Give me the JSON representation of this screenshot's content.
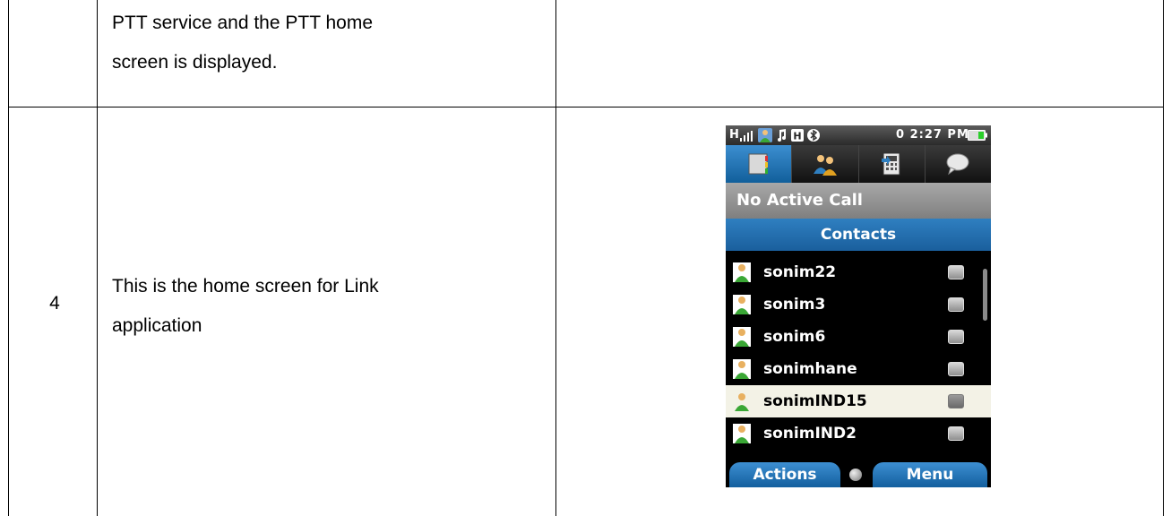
{
  "table": {
    "row1": {
      "step": "",
      "description_lines": [
        "PTT service and the PTT home",
        "screen is displayed."
      ]
    },
    "row2": {
      "step": "4",
      "description_lines": [
        "This is the home screen for Link",
        "application"
      ]
    }
  },
  "phone": {
    "status": {
      "network": "H",
      "time": "0 2:27 PM"
    },
    "tabs": [
      {
        "icon": "ptt-list-icon",
        "active": true
      },
      {
        "icon": "contacts-group-icon",
        "active": false
      },
      {
        "icon": "call-log-icon",
        "active": false
      },
      {
        "icon": "message-bubble-icon",
        "active": false
      }
    ],
    "call_status": "No Active Call",
    "list_header": "Contacts",
    "contacts": [
      {
        "name": "sonim22",
        "selected": false
      },
      {
        "name": "sonim3",
        "selected": false
      },
      {
        "name": "sonim6",
        "selected": false
      },
      {
        "name": "sonimhane",
        "selected": false
      },
      {
        "name": "sonimIND15",
        "selected": true
      },
      {
        "name": "sonimIND2",
        "selected": false
      }
    ],
    "softkeys": {
      "left": "Actions",
      "right": "Menu"
    }
  }
}
